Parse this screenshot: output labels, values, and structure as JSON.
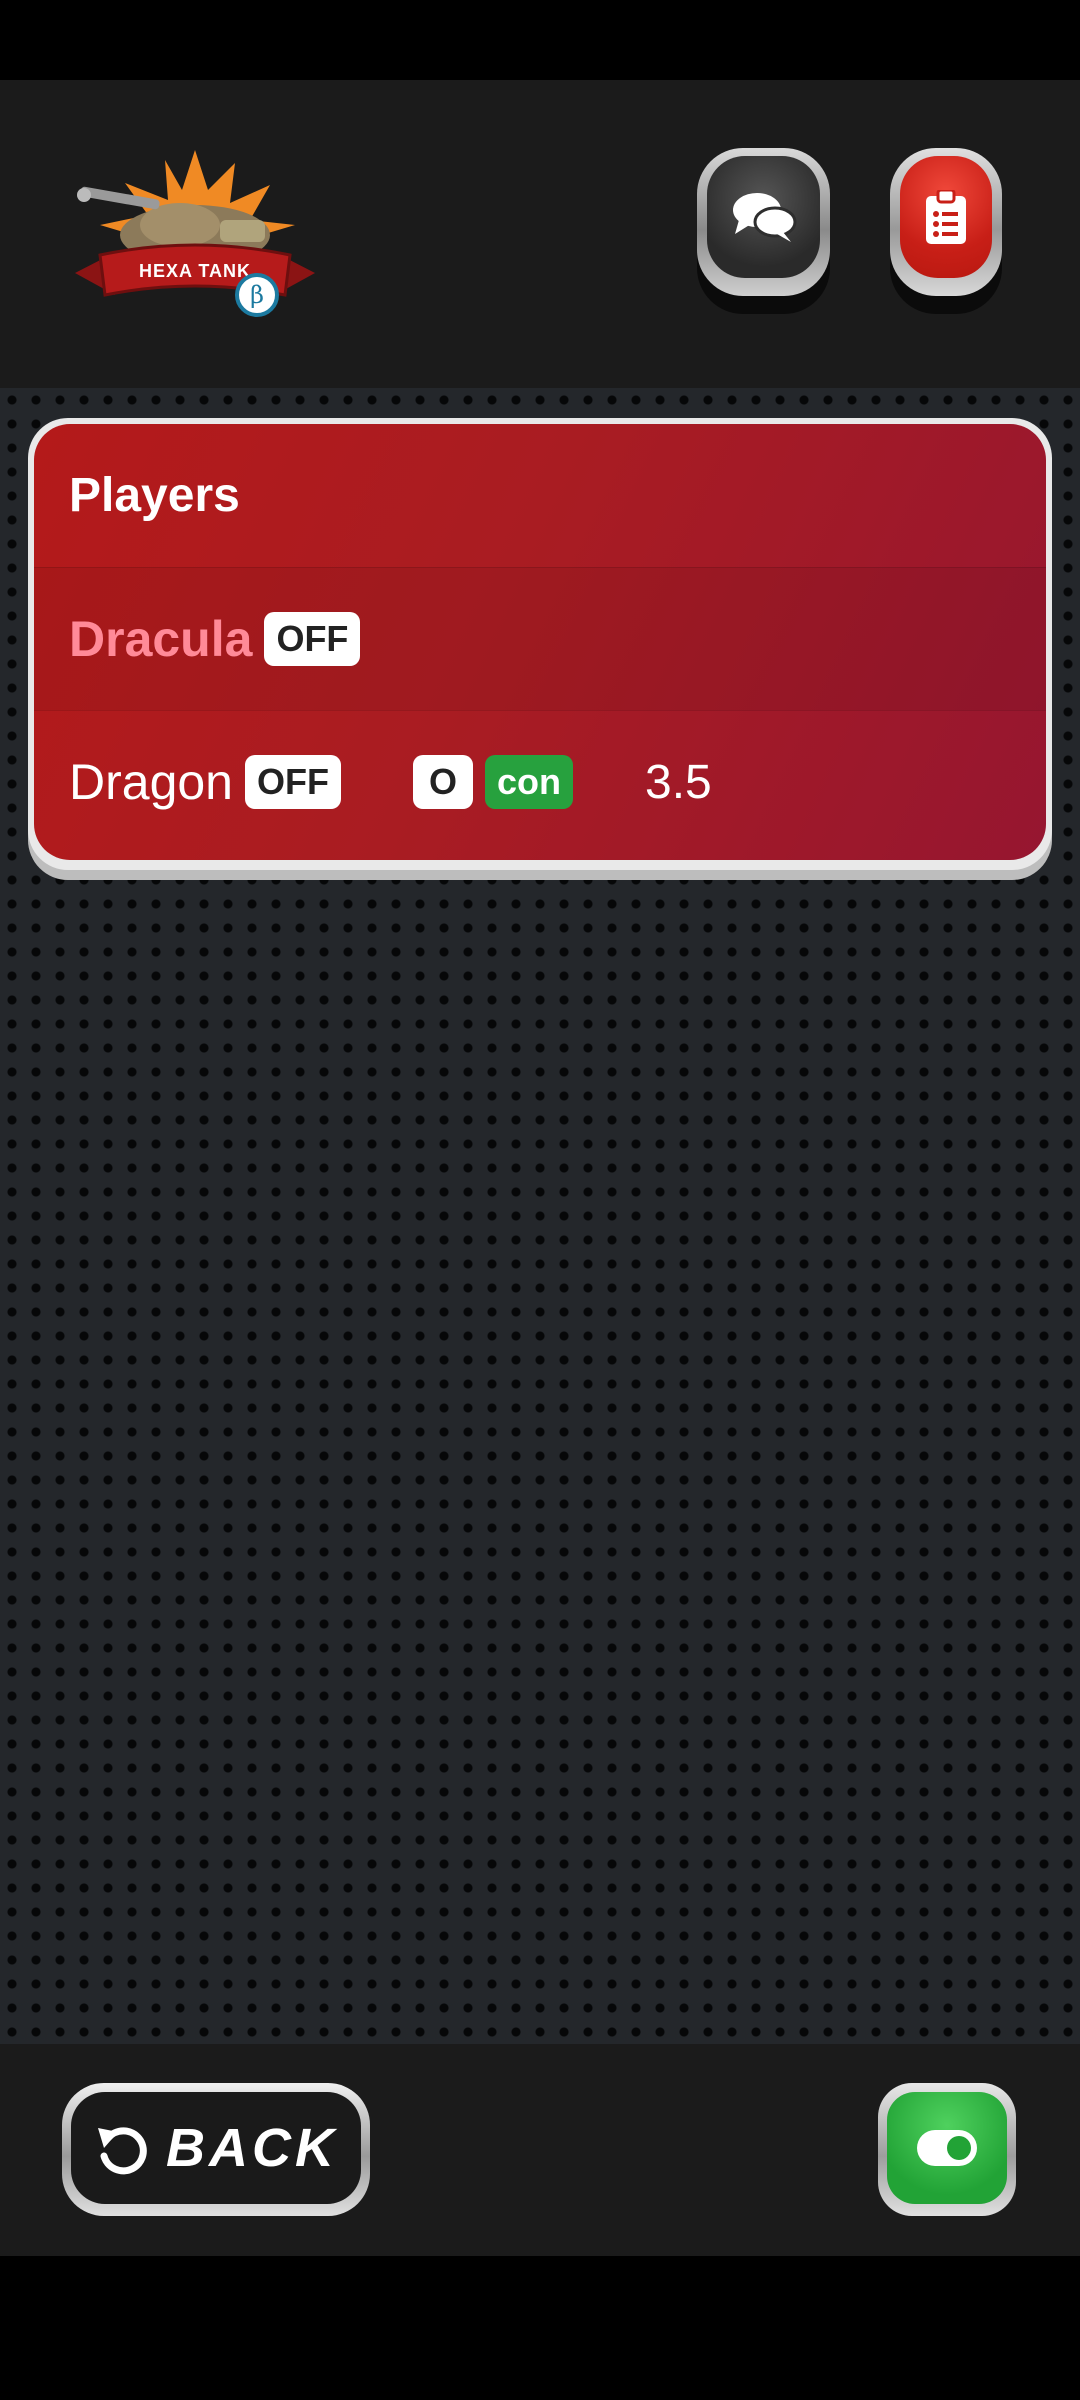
{
  "header": {
    "logo_text": "HEXA TANK",
    "logo_badge": "β",
    "chat_icon": "chat-bubbles-icon",
    "list_icon": "clipboard-list-icon"
  },
  "players_card": {
    "title": "Players",
    "players": [
      {
        "name": "Dracula",
        "status": "OFF",
        "is_self": true
      },
      {
        "name": "Dragon",
        "status": "OFF",
        "team": "O",
        "mode": "con",
        "score": "3.5"
      }
    ]
  },
  "footer": {
    "back_label": "BACK",
    "back_icon": "undo-arrow-icon",
    "toggle_icon": "toggle-on-icon"
  },
  "colors": {
    "card_red": "#a91c22",
    "self_name": "#ff8a98",
    "con_badge": "#27a13e",
    "toggle_green": "#22a336",
    "list_button_red": "#c81f17"
  }
}
